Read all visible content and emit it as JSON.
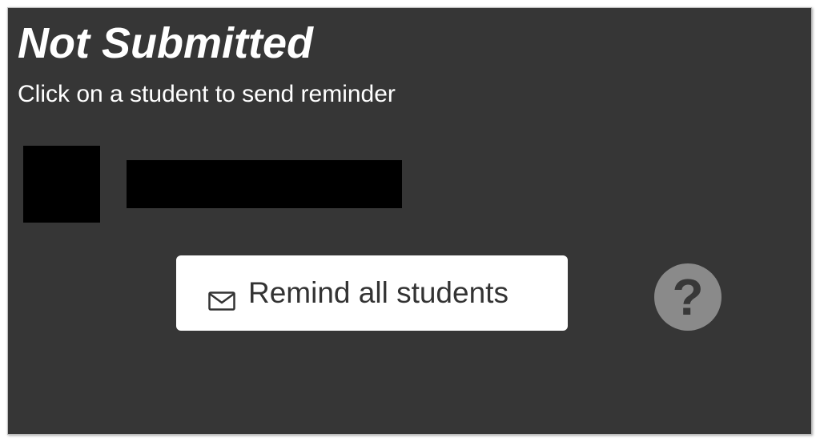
{
  "panel": {
    "title": "Not Submitted",
    "subtitle": "Click on a student to send reminder"
  },
  "students": [
    {
      "name": ""
    }
  ],
  "actions": {
    "remind_all_label": "Remind all students",
    "remind_icon": "mail-icon",
    "help_icon": "question-circle-icon",
    "help_glyph": "?"
  },
  "colors": {
    "panel_background": "#363636",
    "text": "#ffffff",
    "button_background": "#ffffff",
    "button_text": "#333333",
    "help_circle": "#8a8a8a",
    "redaction": "#000000"
  }
}
